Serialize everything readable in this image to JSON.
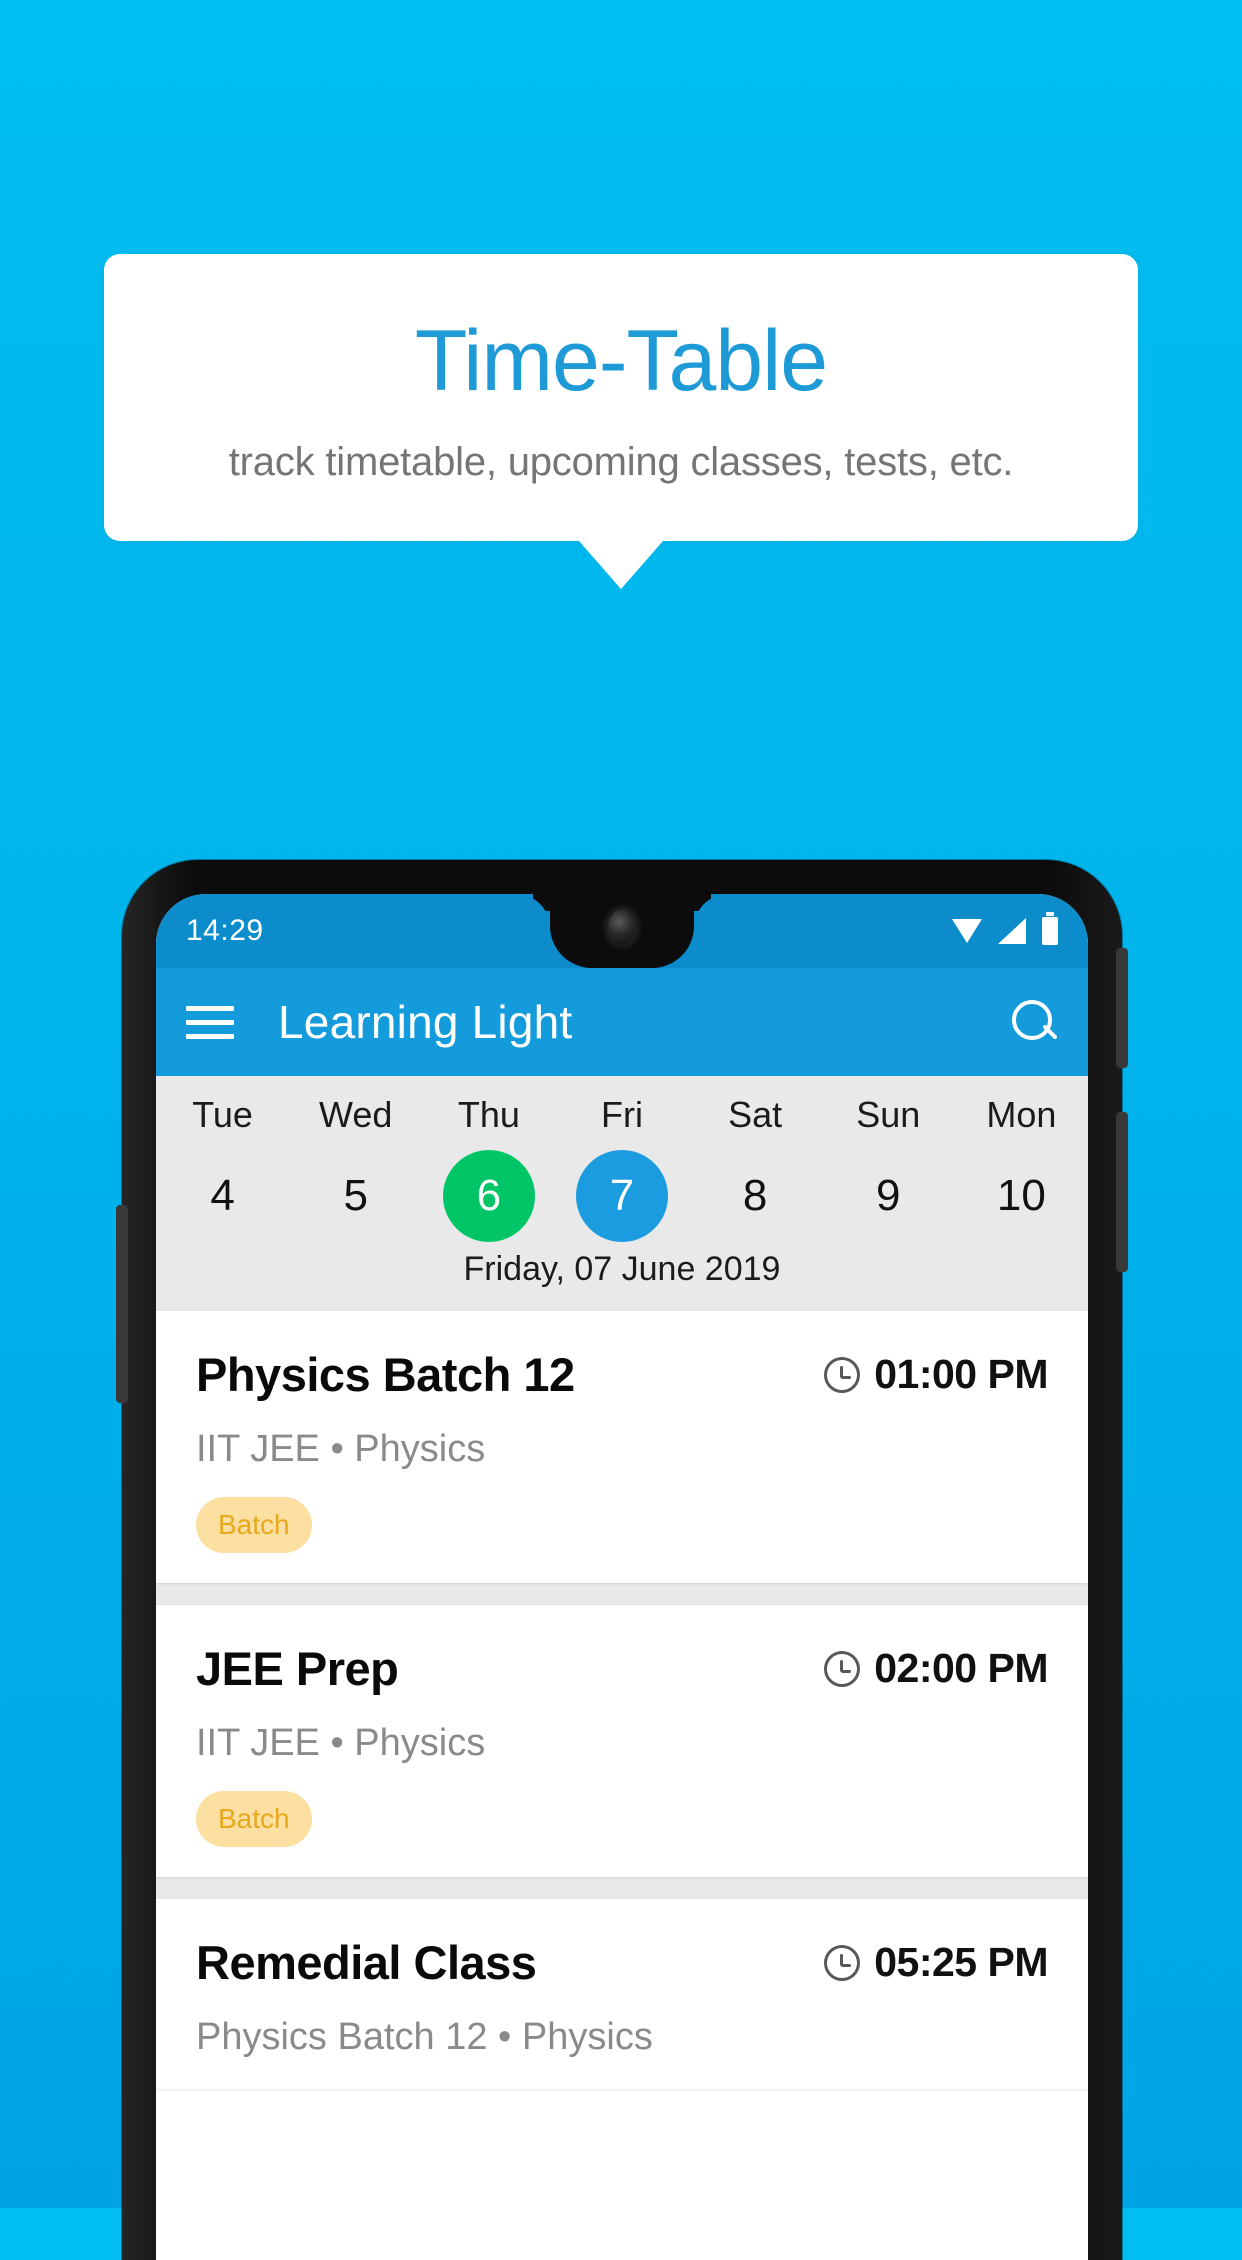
{
  "hero": {
    "title": "Time-Table",
    "subtitle": "track timetable, upcoming classes, tests, etc."
  },
  "colors": {
    "background_top": "#00BEF0",
    "background_bottom": "#00A4E6",
    "brand_blue": "#139BDC",
    "title_blue": "#1E9BD7",
    "today_green": "#00C566",
    "selected_blue": "#1B9BE0",
    "tag_bg": "#FBE0A1",
    "tag_text": "#E8A81E"
  },
  "phone": {
    "statusbar": {
      "time": "14:29",
      "icons": [
        "wifi-icon",
        "signal-icon",
        "battery-icon"
      ]
    },
    "appbar": {
      "menu_icon": "hamburger-menu-icon",
      "title": "Learning Light",
      "search_icon": "search-icon"
    },
    "calendar": {
      "days": [
        {
          "day": "Tue",
          "num": "4",
          "state": "normal"
        },
        {
          "day": "Wed",
          "num": "5",
          "state": "normal"
        },
        {
          "day": "Thu",
          "num": "6",
          "state": "today"
        },
        {
          "day": "Fri",
          "num": "7",
          "state": "selected"
        },
        {
          "day": "Sat",
          "num": "8",
          "state": "normal"
        },
        {
          "day": "Sun",
          "num": "9",
          "state": "normal"
        },
        {
          "day": "Mon",
          "num": "10",
          "state": "normal"
        }
      ],
      "selected_date_label": "Friday, 07 June 2019"
    },
    "classes": [
      {
        "title": "Physics Batch 12",
        "time": "01:00 PM",
        "subtitle": "IIT JEE • Physics",
        "tag": "Batch"
      },
      {
        "title": "JEE Prep",
        "time": "02:00 PM",
        "subtitle": "IIT JEE • Physics",
        "tag": "Batch"
      },
      {
        "title": "Remedial Class",
        "time": "05:25 PM",
        "subtitle": "Physics Batch 12 • Physics",
        "tag": ""
      }
    ]
  }
}
